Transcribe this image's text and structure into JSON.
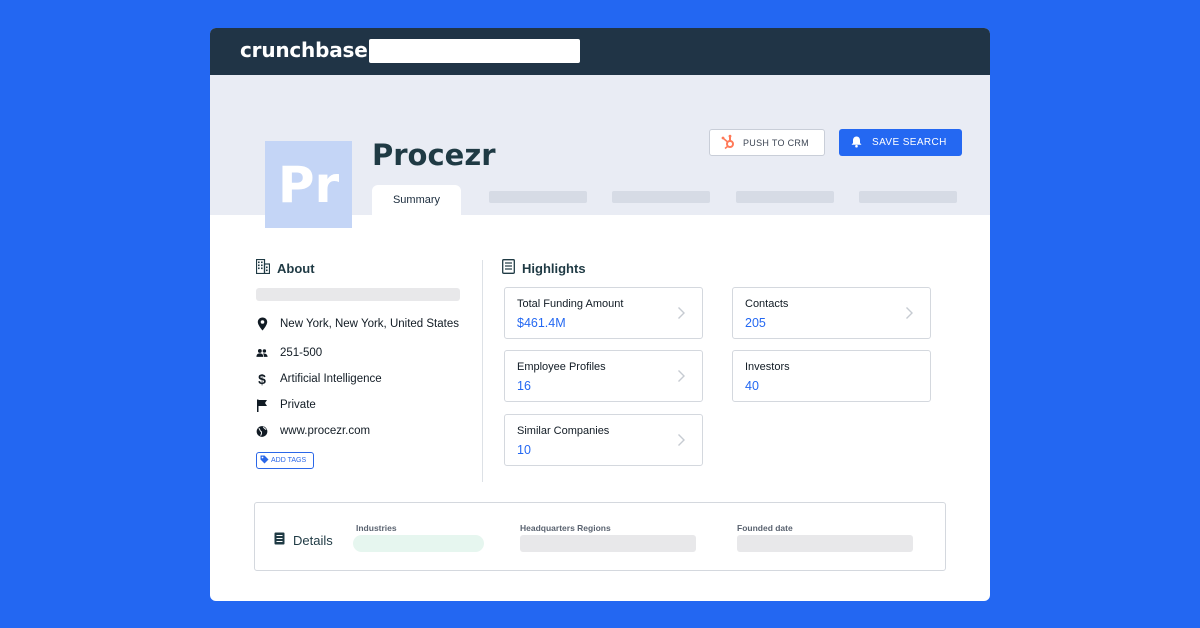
{
  "topbar": {
    "brand": "crunchbase",
    "search_value": ""
  },
  "company": {
    "logo_text": "Pr",
    "name": "Procezr"
  },
  "tabs": {
    "active_label": "Summary"
  },
  "actions": {
    "push_to_crm": "PUSH TO CRM",
    "save_search": "SAVE SEARCH"
  },
  "about": {
    "title": "About",
    "location": "New York, New York, United States",
    "employees": "251-500",
    "industry": "Artificial Intelligence",
    "status": "Private",
    "website": "www.procezr.com",
    "add_tags": "ADD TAGS"
  },
  "highlights": {
    "title": "Highlights",
    "cards": [
      {
        "label": "Total Funding Amount",
        "value": "$461.4M"
      },
      {
        "label": "Contacts",
        "value": "205"
      },
      {
        "label": "Employee Profiles",
        "value": "16"
      },
      {
        "label": "Investors",
        "value": "40"
      },
      {
        "label": "Similar Companies",
        "value": "10"
      }
    ]
  },
  "details": {
    "title": "Details",
    "industries_label": "Industries",
    "hq_label": "Headquarters Regions",
    "founded_label": "Founded date"
  },
  "colors": {
    "background": "#2367f2",
    "topbar": "#203446",
    "accent": "#2468f2",
    "hubspot": "#ff7a59"
  }
}
